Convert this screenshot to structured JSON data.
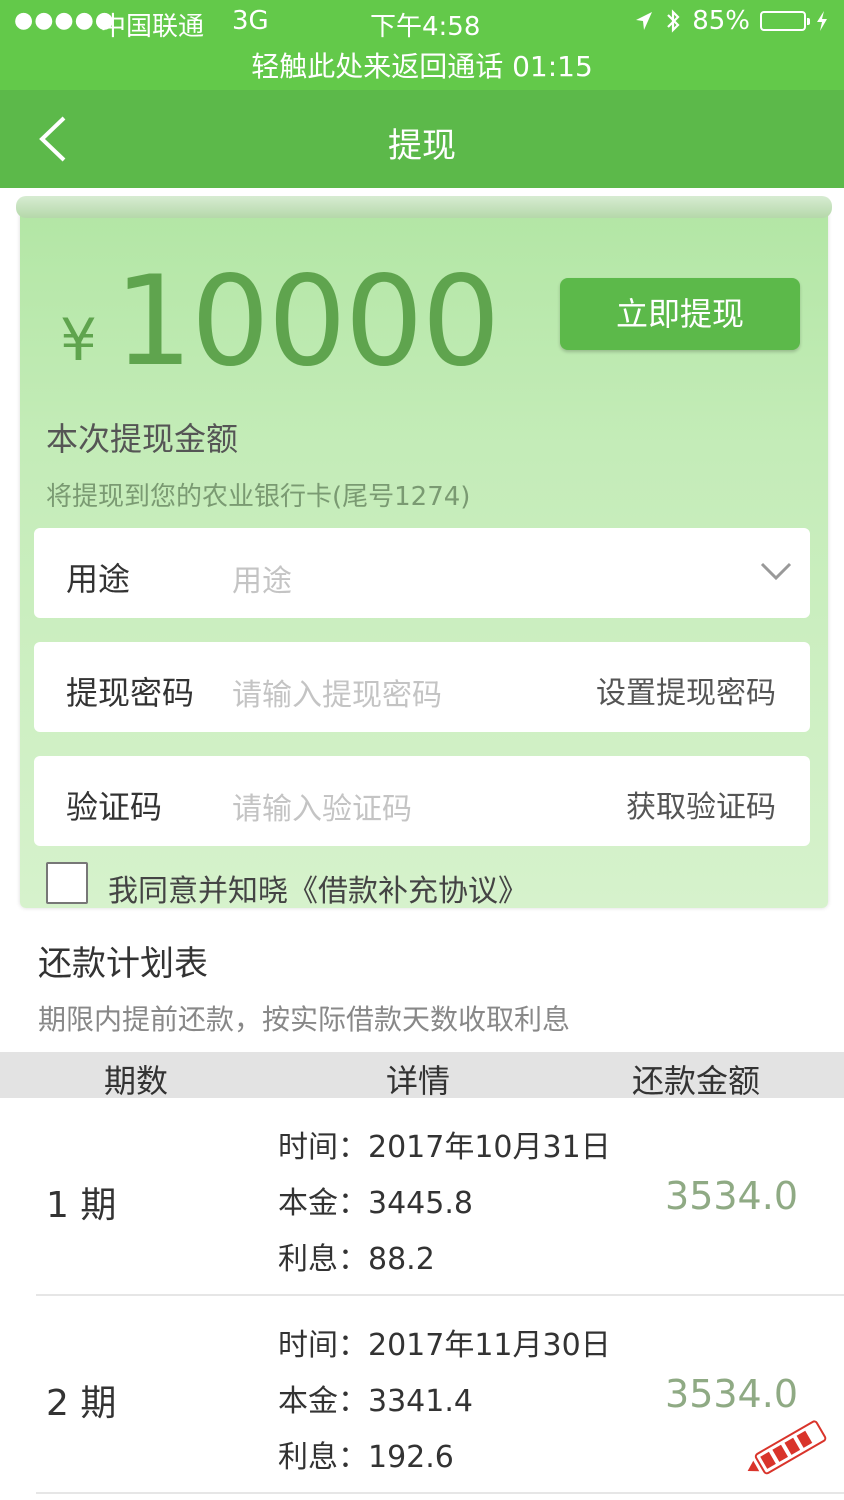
{
  "status_bar": {
    "signal": "●●●●●",
    "carrier": "中国联通",
    "network": "3G",
    "time": "下午4:58",
    "battery": "85%",
    "battery_level": 0.85
  },
  "call_banner": "轻触此处来返回通话 01:15",
  "nav": {
    "title": "提现"
  },
  "withdraw": {
    "currency": "¥",
    "amount": "10000",
    "button_label": "立即提现",
    "caption": "本次提现金额",
    "bank_note": "将提现到您的农业银行卡(尾号1274)"
  },
  "form": {
    "purpose": {
      "label": "用途",
      "placeholder": "用途"
    },
    "password": {
      "label": "提现密码",
      "placeholder": "请输入提现密码",
      "action": "设置提现密码"
    },
    "code": {
      "label": "验证码",
      "placeholder": "请输入验证码",
      "action": "获取验证码"
    },
    "agreement": {
      "prefix": "我同意并知晓",
      "link": "《借款补充协议》"
    }
  },
  "plan": {
    "title": "还款计划表",
    "subtitle": "期限内提前还款，按实际借款天数收取利息",
    "headers": [
      "期数",
      "详情",
      "还款金额"
    ],
    "rows": [
      {
        "period": "1 期",
        "time": "时间：2017年10月31日",
        "principal": "本金：3445.8",
        "interest": "利息：88.2",
        "amount": "3534.0"
      },
      {
        "period": "2 期",
        "time": "时间：2017年11月30日",
        "principal": "本金：3341.4",
        "interest": "利息：192.6",
        "amount": "3534.0"
      }
    ]
  },
  "colors": {
    "brand_green": "#5cb94a",
    "status_green": "#63c94a",
    "amount_green": "#5fa44e",
    "repay_amount": "#8faa84"
  },
  "icons": {
    "back": "chevron-left-icon",
    "location": "location-arrow-icon",
    "bluetooth": "bluetooth-icon",
    "battery": "battery-icon",
    "dropdown": "chevron-down-icon",
    "watermark": "watermark-logo"
  }
}
